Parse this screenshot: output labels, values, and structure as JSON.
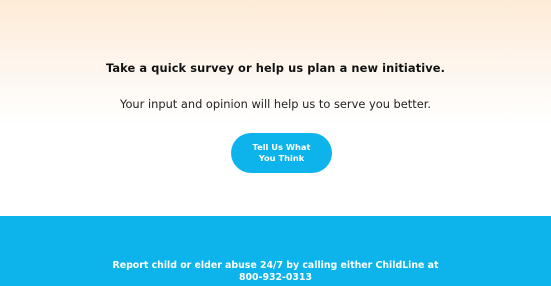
{
  "survey": {
    "heading": "Take a quick survey or help us plan a new initiative.",
    "subtext": "Your input and opinion will help us to serve you better.",
    "button_label": "Tell Us What You Think"
  },
  "footer": {
    "line1": "Report child or elder abuse 24/7 by calling either ChildLine at",
    "line2": "800-932-0313"
  },
  "colors": {
    "accent": "#0db4ec",
    "gradient_top": "#fdebd6",
    "background": "#ffffff"
  }
}
